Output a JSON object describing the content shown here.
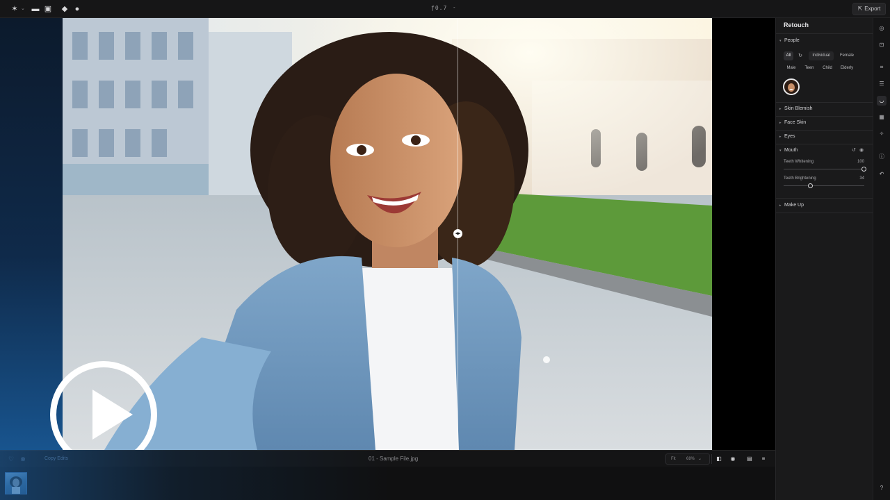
{
  "toolbar": {
    "version": "ƒ0.7",
    "dash": "-",
    "export_label": "Export",
    "icons": [
      "logo-icon",
      "folder-icon",
      "image-icon",
      "eraser-icon",
      "healing-icon"
    ]
  },
  "canvas": {
    "image_description_visible": false
  },
  "bottom_bar": {
    "copy_edits_label": "Copy Edits",
    "filename": "01 - Sample File.jpg",
    "fit_label": "Fit",
    "zoom_label": "68%",
    "zoom_caret": "⌄"
  },
  "panel": {
    "title": "Retouch",
    "people": {
      "label": "People",
      "chips_row1": [
        "All",
        "Individual",
        "Female"
      ],
      "chips_row2": [
        "Male",
        "Teen",
        "Child",
        "Elderly"
      ]
    },
    "sections": {
      "skin_blemish": "Skin Blemish",
      "face_skin": "Face Skin",
      "eyes": "Eyes",
      "mouth": "Mouth",
      "make_up": "Make Up"
    },
    "mouth": {
      "teeth_whitening_label": "Teeth Whitening",
      "teeth_whitening_value": "100",
      "teeth_whitening_level": 1.0,
      "teeth_brightening_label": "Teeth Brightening",
      "teeth_brightening_value": "34",
      "teeth_brightening_level": 0.34
    }
  },
  "colors": {
    "accent_blue": "#1d5f9e",
    "panel_bg": "#1a1a1b",
    "active_chip": "#2e2e31"
  }
}
